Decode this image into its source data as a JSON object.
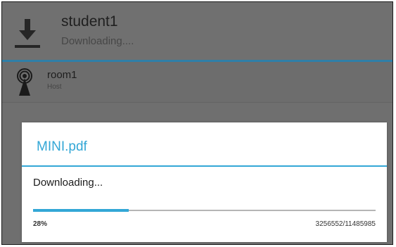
{
  "notification": {
    "title": "student1",
    "status": "Downloading....",
    "icon": "download-icon",
    "accent_color": "#2f7fa8"
  },
  "room_list": {
    "items": [
      {
        "name": "room1",
        "role": "Host",
        "icon": "wifi-tower-icon"
      }
    ]
  },
  "dialog": {
    "title": "MINI.pdf",
    "message": "Downloading...",
    "progress_fraction": 0.28,
    "progress_percent_text": "28%",
    "progress_count_text": "3256552/11485985",
    "accent_color": "#33a7d6"
  }
}
